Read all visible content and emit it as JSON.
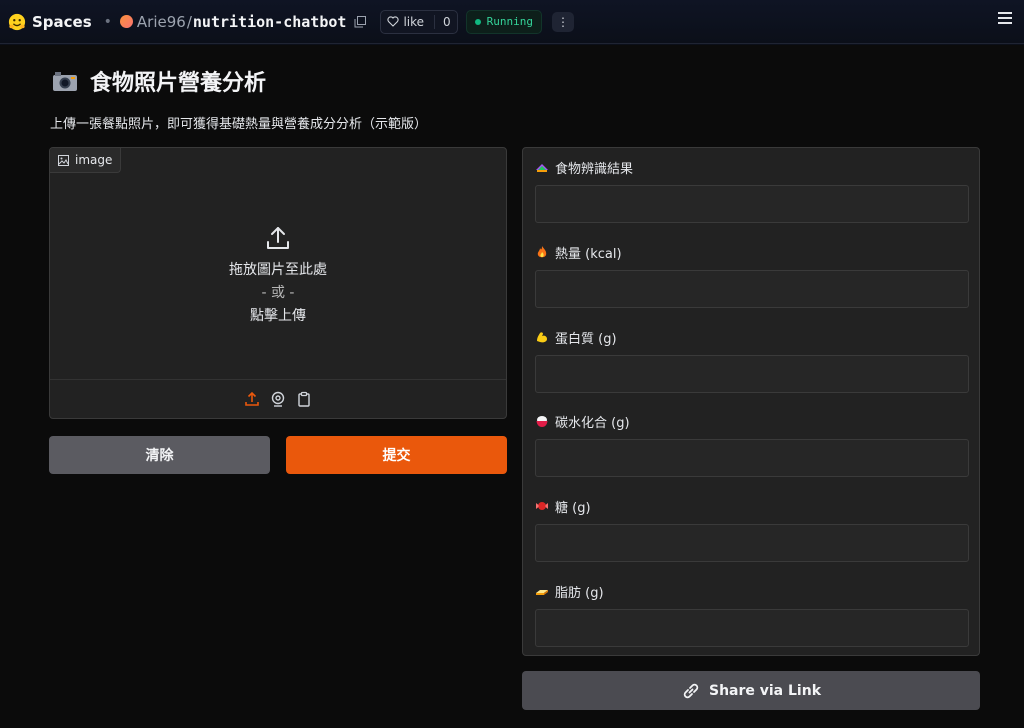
{
  "header": {
    "spaces_label": "Spaces",
    "owner": "Arie96",
    "separator": "/",
    "repo": "nutrition-chatbot",
    "like_label": "like",
    "like_count": "0",
    "status": "Running",
    "more_label": "⋮"
  },
  "page": {
    "title": "食物照片營養分析",
    "subtitle": "上傳一張餐點照片，即可獲得基礎熱量與營養成分分析（示範版）"
  },
  "upload": {
    "tag": "image",
    "drop_text": "拖放圖片至此處",
    "or_text": "- 或 -",
    "click_text": "點擊上傳"
  },
  "buttons": {
    "clear": "清除",
    "submit": "提交",
    "share": "Share via Link"
  },
  "results": {
    "fields": [
      {
        "label": "食物辨識結果",
        "icon": "food-icon",
        "value": ""
      },
      {
        "label": "熱量 (kcal)",
        "icon": "fire-icon",
        "value": ""
      },
      {
        "label": "蛋白質 (g)",
        "icon": "muscle-icon",
        "value": ""
      },
      {
        "label": "碳水化合 (g)",
        "icon": "rice-icon",
        "value": ""
      },
      {
        "label": "糖 (g)",
        "icon": "candy-icon",
        "value": ""
      },
      {
        "label": "脂肪 (g)",
        "icon": "butter-icon",
        "value": ""
      }
    ]
  },
  "colors": {
    "accent": "#ea580c",
    "status": "#34d399",
    "background": "#0b0b0b"
  }
}
